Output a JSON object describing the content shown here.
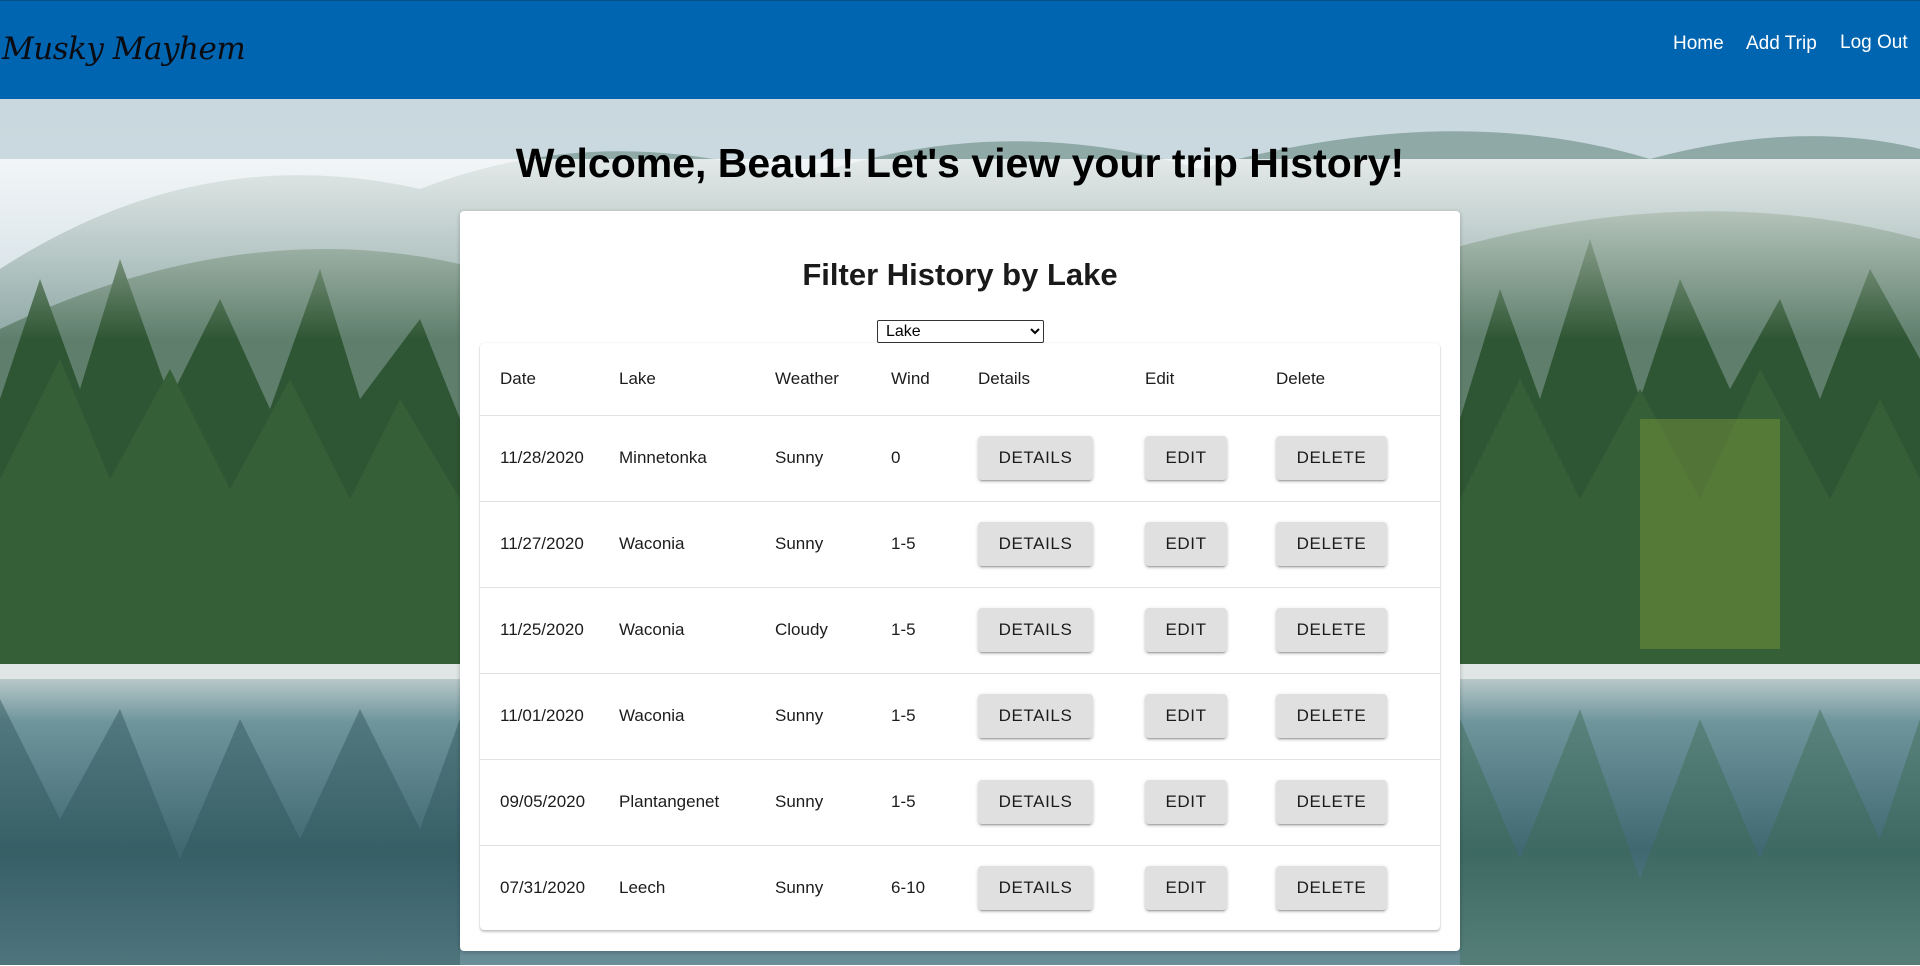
{
  "nav": {
    "brand": "Musky Mayhem",
    "links": [
      "Home",
      "Add Trip",
      "Log Out"
    ]
  },
  "welcome": "Welcome, Beau1! Let's view your trip History!",
  "filter": {
    "title": "Filter History by Lake",
    "select_value": "Lake"
  },
  "table": {
    "headers": [
      "Date",
      "Lake",
      "Weather",
      "Wind",
      "Details",
      "Edit",
      "Delete"
    ],
    "rows": [
      {
        "date": "11/28/2020",
        "lake": "Minnetonka",
        "weather": "Sunny",
        "wind": "0"
      },
      {
        "date": "11/27/2020",
        "lake": "Waconia",
        "weather": "Sunny",
        "wind": "1-5"
      },
      {
        "date": "11/25/2020",
        "lake": "Waconia",
        "weather": "Cloudy",
        "wind": "1-5"
      },
      {
        "date": "11/01/2020",
        "lake": "Waconia",
        "weather": "Sunny",
        "wind": "1-5"
      },
      {
        "date": "09/05/2020",
        "lake": "Plantangenet",
        "weather": "Sunny",
        "wind": "1-5"
      },
      {
        "date": "07/31/2020",
        "lake": "Leech",
        "weather": "Sunny",
        "wind": "6-10"
      }
    ],
    "buttons": {
      "details": "DETAILS",
      "edit": "EDIT",
      "delete": "DELETE"
    }
  },
  "colors": {
    "navbar": "#0065b0",
    "button_bg": "#e0e0e0"
  },
  "background_image": "misty-forest-lake-photo"
}
